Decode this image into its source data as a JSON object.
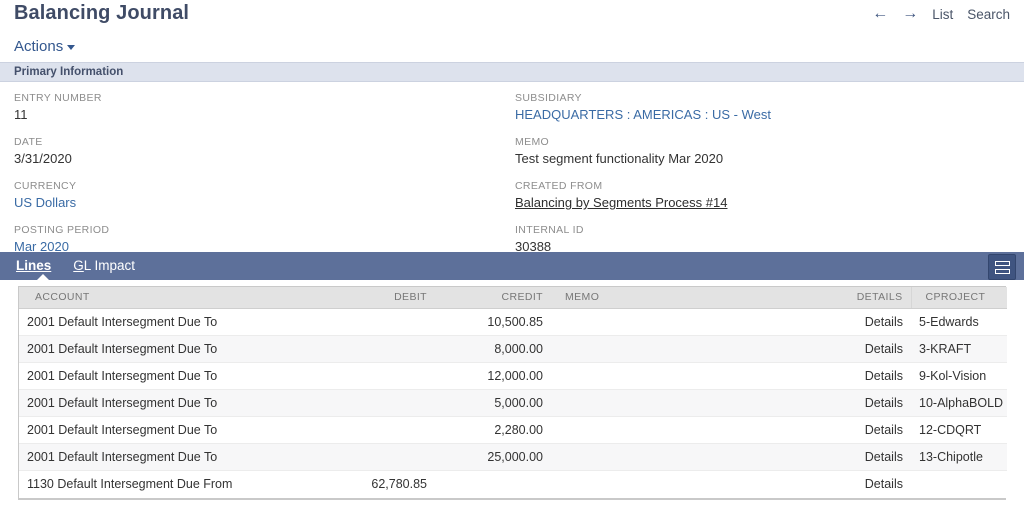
{
  "header": {
    "title": "Balancing Journal",
    "back_icon": "arrow-left-icon",
    "forward_icon": "arrow-right-icon",
    "list_label": "List",
    "search_label": "Search"
  },
  "actions": {
    "label": "Actions",
    "caret_icon": "caret-down-icon"
  },
  "section": {
    "title": "Primary Information"
  },
  "fields": {
    "left": [
      {
        "label": "ENTRY NUMBER",
        "value": "11",
        "style": "plain"
      },
      {
        "label": "DATE",
        "value": "3/31/2020",
        "style": "plain"
      },
      {
        "label": "CURRENCY",
        "value": "US Dollars",
        "style": "link"
      },
      {
        "label": "POSTING PERIOD",
        "value": "Mar 2020",
        "style": "link"
      }
    ],
    "right": [
      {
        "label": "SUBSIDIARY",
        "value": "HEADQUARTERS : AMERICAS : US - West",
        "style": "link"
      },
      {
        "label": "MEMO",
        "value": "Test segment functionality Mar 2020",
        "style": "plain"
      },
      {
        "label": "CREATED FROM",
        "value": "Balancing by Segments Process #14",
        "style": "underline"
      },
      {
        "label": "INTERNAL ID",
        "value": "30388",
        "style": "plain"
      }
    ]
  },
  "tabs": {
    "items": [
      {
        "label": "Lines",
        "active": true
      },
      {
        "label": "GL Impact",
        "active": false
      }
    ],
    "view_toggle_icon": "list-view-toggle-icon"
  },
  "table": {
    "columns": [
      {
        "key": "account",
        "label": "ACCOUNT"
      },
      {
        "key": "debit",
        "label": "DEBIT"
      },
      {
        "key": "credit",
        "label": "CREDIT"
      },
      {
        "key": "memo",
        "label": "MEMO"
      },
      {
        "key": "details",
        "label": "DETAILS"
      },
      {
        "key": "cproject",
        "label": "CPROJECT"
      }
    ],
    "rows": [
      {
        "account": "2001 Default Intersegment Due To",
        "debit": "",
        "credit": "10,500.85",
        "memo": "",
        "details": "Details",
        "cproject": "5-Edwards"
      },
      {
        "account": "2001 Default Intersegment Due To",
        "debit": "",
        "credit": "8,000.00",
        "memo": "",
        "details": "Details",
        "cproject": "3-KRAFT"
      },
      {
        "account": "2001 Default Intersegment Due To",
        "debit": "",
        "credit": "12,000.00",
        "memo": "",
        "details": "Details",
        "cproject": "9-Kol-Vision"
      },
      {
        "account": "2001 Default Intersegment Due To",
        "debit": "",
        "credit": "5,000.00",
        "memo": "",
        "details": "Details",
        "cproject": "10-AlphaBOLD"
      },
      {
        "account": "2001 Default Intersegment Due To",
        "debit": "",
        "credit": "2,280.00",
        "memo": "",
        "details": "Details",
        "cproject": "12-CDQRT"
      },
      {
        "account": "2001 Default Intersegment Due To",
        "debit": "",
        "credit": "25,000.00",
        "memo": "",
        "details": "Details",
        "cproject": "13-Chipotle"
      },
      {
        "account": "1130 Default Intersegment Due From",
        "debit": "62,780.85",
        "credit": "",
        "memo": "",
        "details": "Details",
        "cproject": ""
      }
    ]
  },
  "colors": {
    "link": "#3a6ba5",
    "tabstrip": "#5d709a",
    "section_band": "#dde2ed",
    "title": "#3f4b66"
  }
}
